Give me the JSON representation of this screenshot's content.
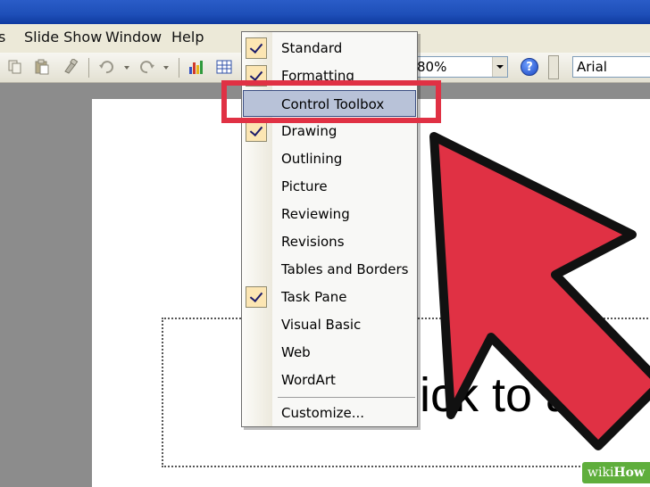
{
  "menubar": {
    "items": [
      {
        "label": "s"
      },
      {
        "label": "Slide Show"
      },
      {
        "label": "Window"
      },
      {
        "label": "Help"
      }
    ]
  },
  "toolbar": {
    "zoom_value": "80%",
    "font_value": "Arial",
    "help_icon_text": "?",
    "icons": [
      "copy-icon",
      "paste-icon",
      "format-painter-icon",
      "undo-icon",
      "redo-icon",
      "chart-icon",
      "table-icon"
    ]
  },
  "menu": {
    "items": [
      {
        "label": "Standard",
        "checked": true,
        "selected": false
      },
      {
        "label": "Formatting",
        "checked": true,
        "selected": false
      },
      {
        "label": "Control Toolbox",
        "checked": false,
        "selected": true
      },
      {
        "label": "Drawing",
        "checked": true,
        "selected": false
      },
      {
        "label": "Outlining",
        "checked": false,
        "selected": false
      },
      {
        "label": "Picture",
        "checked": false,
        "selected": false
      },
      {
        "label": "Reviewing",
        "checked": false,
        "selected": false
      },
      {
        "label": "Revisions",
        "checked": false,
        "selected": false
      },
      {
        "label": "Tables and Borders",
        "checked": false,
        "selected": false
      },
      {
        "label": "Task Pane",
        "checked": true,
        "selected": false
      },
      {
        "label": "Visual Basic",
        "checked": false,
        "selected": false
      },
      {
        "label": "Web",
        "checked": false,
        "selected": false
      },
      {
        "label": "WordArt",
        "checked": false,
        "selected": false
      }
    ],
    "customize_label": "Customize..."
  },
  "slide": {
    "placeholder_text": "ick to add"
  },
  "annotation": {
    "accent_color": "#e03144"
  },
  "watermark": {
    "prefix": "wiki",
    "brand": "How"
  }
}
